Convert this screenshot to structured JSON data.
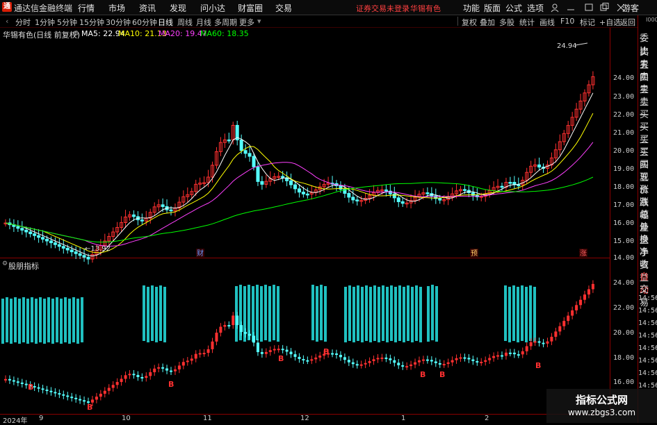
{
  "app": {
    "title": "通达信金融终端",
    "logo": "通"
  },
  "menu": [
    "行情",
    "市场",
    "资讯",
    "发现",
    "问小达",
    "财富圈",
    "交易"
  ],
  "status": {
    "broker": "证券交易未登录",
    "stock": "华锡有色"
  },
  "right_menu": [
    "功能",
    "版面",
    "公式",
    "选项"
  ],
  "guest": "游客",
  "periods": [
    "分时",
    "1分钟",
    "5分钟",
    "15分钟",
    "30分钟",
    "60分钟",
    "日线",
    "周线",
    "月线",
    "多周期",
    "更多"
  ],
  "active_period": "日线",
  "tools": [
    "复权",
    "叠加",
    "多股",
    "统计",
    "画线",
    "F10",
    "标记",
    "+自选",
    "返回"
  ],
  "stock_info": "华锡有色(日线 前复权)",
  "ma": [
    {
      "label": "MA5: 22.94",
      "color": "#ffffff"
    },
    {
      "label": "MA10: 21.13",
      "color": "#ffff00"
    },
    {
      "label": "MA20: 19.47",
      "color": "#ff40ff"
    },
    {
      "label": "MA60: 18.35",
      "color": "#00ff00"
    }
  ],
  "price_axis": [
    "24.00",
    "23.00",
    "22.00",
    "21.00",
    "20.00",
    "19.00",
    "18.00",
    "17.00",
    "16.00",
    "15.00",
    "14.00"
  ],
  "ind_axis": [
    "24.00",
    "22.00",
    "20.00",
    "18.00",
    "16.00"
  ],
  "high_label": "24.94",
  "low_label": "13.92",
  "event_markers": {
    "cai": "财",
    "yu": "预",
    "zhang": "涨"
  },
  "indicator_title": "股朋指标",
  "buy_marker": "B",
  "side_items": [
    "委比",
    "卖五",
    "卖四",
    "卖三",
    "卖二",
    "卖一",
    "买一",
    "买二",
    "买三",
    "买四",
    "买五",
    "现价",
    "涨跌",
    "涨幅",
    "总量",
    "外盘",
    "换手",
    "净资",
    "收益",
    "自动",
    "交易"
  ],
  "side_times": [
    "14:56",
    "14:56",
    "14:56",
    "14:56",
    "14:56",
    "14:56",
    "14:56",
    "14:56"
  ],
  "side_top": "I000",
  "dates": [
    "2024年",
    "9",
    "10",
    "11",
    "12",
    "1",
    "2"
  ],
  "watermark": {
    "title": "指标公式网",
    "url": "www.zbgs3.com"
  },
  "colors": {
    "up": "#ff3030",
    "down": "#54ffff",
    "ma5": "#ffffff",
    "ma10": "#ffff00",
    "ma20": "#ff40ff",
    "ma60": "#00ff00",
    "bar": "#20c0c0"
  }
}
